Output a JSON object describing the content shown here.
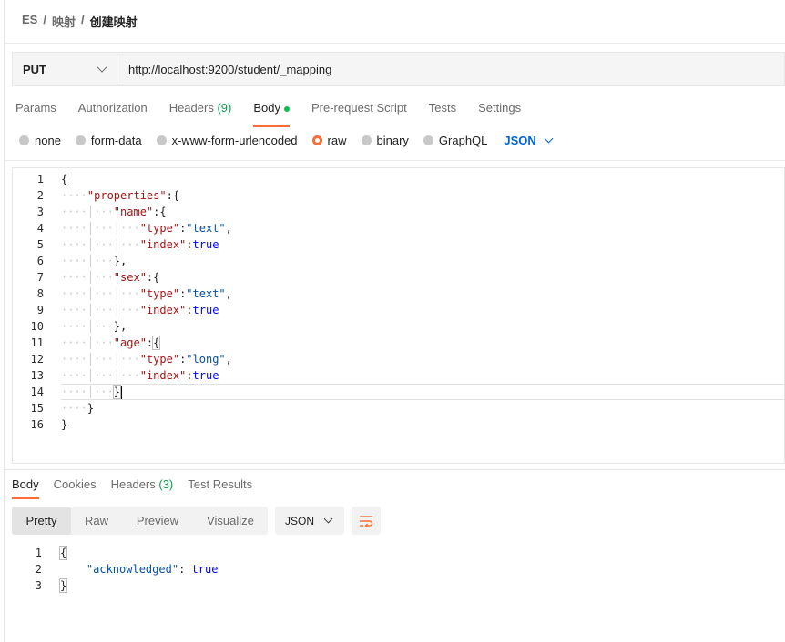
{
  "breadcrumb": [
    "ES",
    "映射",
    "创建映射"
  ],
  "request": {
    "method": "PUT",
    "url": "http://localhost:9200/student/_mapping"
  },
  "request_tabs": [
    {
      "label": "Params"
    },
    {
      "label": "Authorization"
    },
    {
      "label": "Headers",
      "count": "(9)"
    },
    {
      "label": "Body",
      "active": true
    },
    {
      "label": "Pre-request Script"
    },
    {
      "label": "Tests"
    },
    {
      "label": "Settings"
    }
  ],
  "body_types": [
    "none",
    "form-data",
    "x-www-form-urlencoded",
    "raw",
    "binary",
    "GraphQL"
  ],
  "body_type_selected": "raw",
  "body_format": "JSON",
  "request_body_lines": [
    "{",
    "    \"properties\":{",
    "        \"name\":{",
    "            \"type\":\"text\",",
    "            \"index\":true",
    "        },",
    "        \"sex\":{",
    "            \"type\":\"text\",",
    "            \"index\":true",
    "        },",
    "        \"age\":{",
    "            \"type\":\"long\",",
    "            \"index\":true",
    "        }",
    "    }",
    "}"
  ],
  "response_tabs": [
    {
      "label": "Body",
      "active": true
    },
    {
      "label": "Cookies"
    },
    {
      "label": "Headers",
      "count": "(3)"
    },
    {
      "label": "Test Results"
    }
  ],
  "view_modes": [
    "Pretty",
    "Raw",
    "Preview",
    "Visualize"
  ],
  "view_mode_selected": "Pretty",
  "response_format": "JSON",
  "response_lines": [
    "{",
    "    \"acknowledged\": true",
    "}"
  ],
  "colors": {
    "accent": "#ff6c37",
    "json_link": "#0265d2",
    "count_green": "#0c9a50",
    "code_key": "#a31515",
    "code_string": "#0451a5",
    "code_bool": "#0000ff"
  },
  "icons": [
    "chevron-down-icon",
    "wrap-lines-icon"
  ]
}
